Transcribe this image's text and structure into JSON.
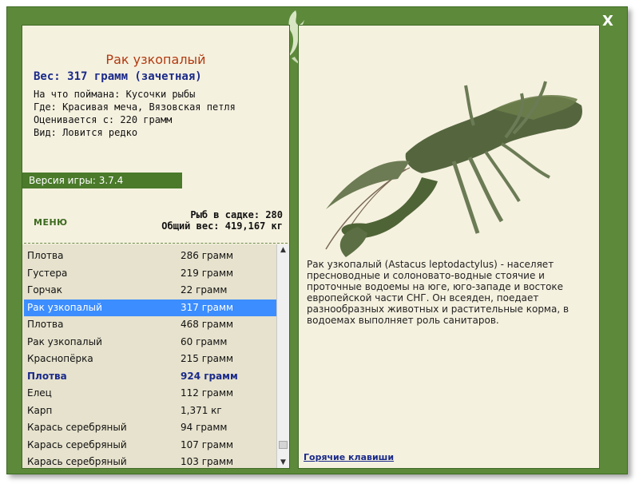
{
  "window": {
    "close_label": "X"
  },
  "fish": {
    "title": "Рак узкопалый",
    "weight_line": "Вес: 317 грамм (зачетная)",
    "info": [
      "На что поймана: Кусочки рыбы",
      "Где: Красивая меча, Вязовская петля",
      "Оценивается с: 220 грамм",
      "Вид: Ловится редко"
    ],
    "description": "Рак узкопалый (Astacus leptodactylus) - населяет пресноводные и солоновато-водные стоячие и проточные водоемы на юге, юго-западе и востоке европейской части СНГ. Он всеяден, поедает разнообразных животных и растительные корма, в водоемах выполняет роль санитаров."
  },
  "game": {
    "version": "Версия игры: 3.7.4",
    "menu_label": "МЕНЮ"
  },
  "stats": {
    "fish_in_cage": "Рыб в садке: 280",
    "total_weight": "Общий вес: 419,167 кг"
  },
  "catch_list": [
    {
      "name": "Плотва",
      "weight": "286 грамм",
      "state": "normal"
    },
    {
      "name": "Густера",
      "weight": "219 грамм",
      "state": "normal"
    },
    {
      "name": "Горчак",
      "weight": "22 грамм",
      "state": "normal"
    },
    {
      "name": "Рак узкопалый",
      "weight": "317 грамм",
      "state": "selected"
    },
    {
      "name": "Плотва",
      "weight": "468 грамм",
      "state": "normal"
    },
    {
      "name": "Рак узкопалый",
      "weight": "60 грамм",
      "state": "normal"
    },
    {
      "name": "Краснопёрка",
      "weight": "215 грамм",
      "state": "normal"
    },
    {
      "name": "Плотва",
      "weight": "924 грамм",
      "state": "bold"
    },
    {
      "name": "Елец",
      "weight": "112 грамм",
      "state": "normal"
    },
    {
      "name": "Карп",
      "weight": "1,371 кг",
      "state": "normal"
    },
    {
      "name": "Карась серебряный",
      "weight": "94 грамм",
      "state": "normal"
    },
    {
      "name": "Карась серебряный",
      "weight": "107 грамм",
      "state": "normal"
    },
    {
      "name": "Карась серебряный",
      "weight": "103 грамм",
      "state": "normal"
    }
  ],
  "links": {
    "hotkeys": "Горячие клавиши"
  },
  "colors": {
    "frame": "#5c8a3a",
    "panel": "#f5f1df",
    "selected_row": "#3c8dff",
    "title_color": "#b23a10",
    "accent_blue": "#1a2a8a"
  },
  "icons": {
    "logo": "fish-logo-icon",
    "close": "close-icon",
    "scroll_up": "scroll-up-icon",
    "scroll_down": "scroll-down-icon"
  }
}
